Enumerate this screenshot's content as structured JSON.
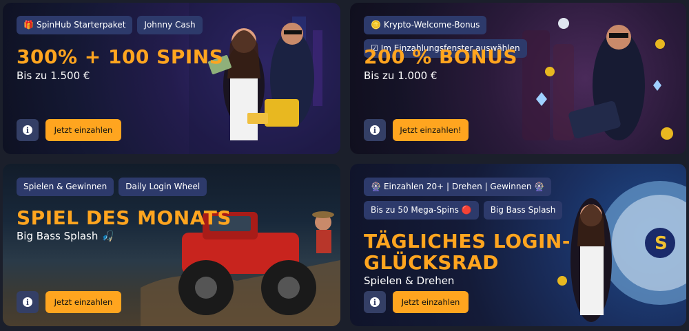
{
  "cards": [
    {
      "badges": [
        {
          "icon": "gift-icon",
          "glyph": "🎁",
          "label": "SpinHub Starterpaket"
        },
        {
          "label": "Johnny Cash"
        }
      ],
      "headline": "300% + 100 SPINS",
      "subline": "Bis zu 1.500 €",
      "info_label": "i",
      "cta_label": "Jetzt einzahlen"
    },
    {
      "badges": [
        {
          "icon": "coin-icon",
          "glyph": "🪙",
          "label": "Krypto-Welcome-Bonus"
        },
        {
          "icon": "checkbox-icon",
          "glyph": "☑",
          "label": "Im Einzahlungsfenster auswählen"
        }
      ],
      "headline": "200 % BONUS",
      "subline": "Bis zu 1.000 €",
      "info_label": "i",
      "cta_label": "Jetzt einzahlen!"
    },
    {
      "badges": [
        {
          "label": "Spielen & Gewinnen"
        },
        {
          "label": "Daily Login Wheel"
        }
      ],
      "headline": "SPIEL DES MONATS",
      "subline": "Big Bass Splash",
      "subline_icon_glyph": "🎣",
      "info_label": "i",
      "cta_label": "Jetzt einzahlen"
    },
    {
      "badges": [
        {
          "icon": "wheel-icon",
          "glyph": "🎡",
          "label": "Einzahlen 20+ | Drehen | Gewinnen",
          "glyph_after": "🎡"
        },
        {
          "label": "Bis zu 50 Mega-Spins",
          "glyph_after": "🔴"
        },
        {
          "label": "Big Bass Splash"
        }
      ],
      "headline_line1": "TÄGLICHES LOGIN-",
      "headline_line2": "GLÜCKSRAD",
      "subline": "Spielen & Drehen",
      "info_label": "i",
      "cta_label": "Jetzt einzahlen"
    }
  ]
}
